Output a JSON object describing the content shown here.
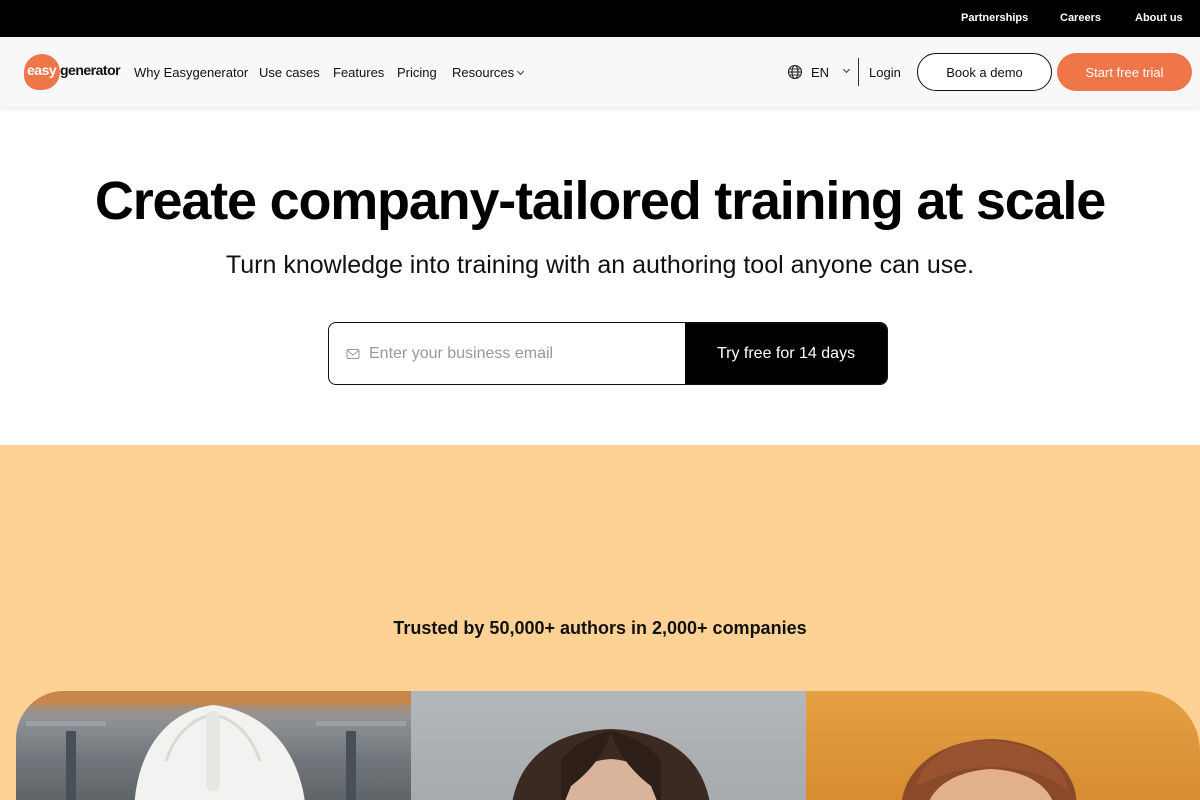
{
  "topbar": {
    "links": [
      "Partnerships",
      "Careers",
      "About us"
    ]
  },
  "nav": {
    "logo_easy": "easy",
    "logo_generator": "generator",
    "links": [
      "Why Easygenerator",
      "Use cases",
      "Features",
      "Pricing"
    ],
    "resources_label": "Resources",
    "lang": "EN",
    "login": "Login",
    "book_demo": "Book a demo",
    "start_trial": "Start free trial"
  },
  "hero": {
    "title": "Create company-tailored training at scale",
    "subtitle": "Turn knowledge into training with an authoring tool anyone can use.",
    "email_placeholder": "Enter your business email",
    "email_value": "",
    "cta": "Try free for 14 days"
  },
  "trust": {
    "text": "Trusted by 50,000+ authors in 2,000+ companies"
  },
  "colors": {
    "brand_orange": "#ee7649",
    "peach_band": "#fdd294",
    "top_bar": "#000000"
  },
  "icons": [
    "globe-icon",
    "chevron-down-icon",
    "mail-icon"
  ]
}
